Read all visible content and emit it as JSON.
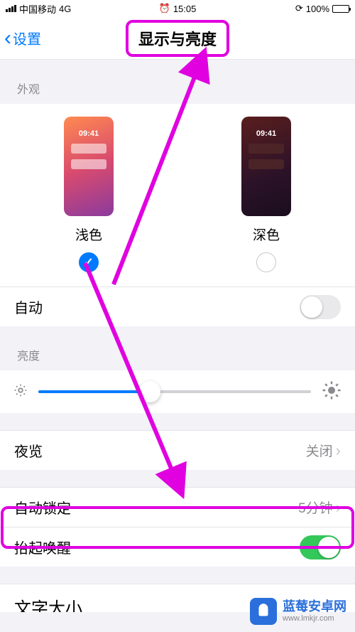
{
  "status": {
    "carrier": "中国移动",
    "network": "4G",
    "time": "15:05",
    "battery_text": "100%"
  },
  "nav": {
    "back_label": "设置",
    "title": "显示与亮度"
  },
  "sections": {
    "appearance": "外观",
    "brightness": "亮度"
  },
  "appearance": {
    "light": {
      "label": "浅色",
      "preview_time": "09:41",
      "selected": true
    },
    "dark": {
      "label": "深色",
      "preview_time": "09:41",
      "selected": false
    }
  },
  "rows": {
    "auto": "自动",
    "night_shift": {
      "label": "夜览",
      "value": "关闭"
    },
    "auto_lock": {
      "label": "自动锁定",
      "value": "5分钟"
    },
    "raise_to_wake": "抬起唤醒",
    "text_size_cutoff": "文字大小"
  },
  "brightness": {
    "percent": 41
  },
  "watermark": {
    "title": "蓝莓安卓网",
    "url": "www.lmkjr.com"
  }
}
